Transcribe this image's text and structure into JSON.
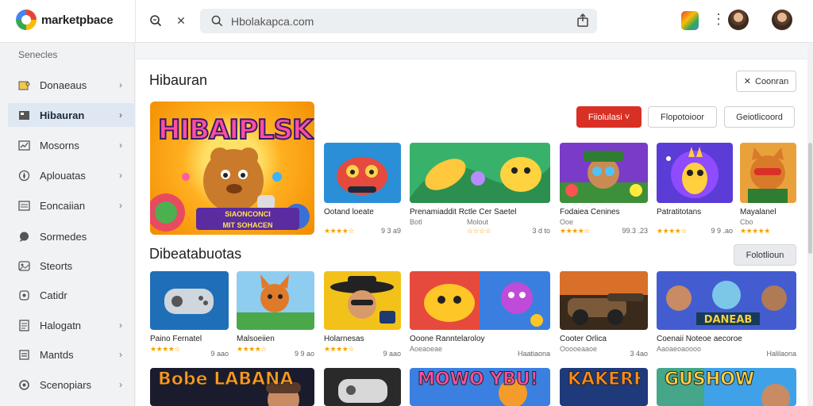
{
  "app": {
    "title": "marketpbace"
  },
  "search": {
    "value": "Hbolakapca.com",
    "placeholder": ""
  },
  "sidebar": {
    "header": "Senecles",
    "items": [
      {
        "label": "Donaeaus",
        "icon": "puzzle-icon",
        "chevron": true
      },
      {
        "label": "Hibauran",
        "icon": "grid-icon",
        "chevron": true,
        "active": true
      },
      {
        "label": "Mosorns",
        "icon": "chart-icon",
        "chevron": true
      },
      {
        "label": "Aplouatas",
        "icon": "compass-icon",
        "chevron": true
      },
      {
        "label": "Eoncaiian",
        "icon": "list-icon",
        "chevron": true
      },
      {
        "label": "Sormedes",
        "icon": "chat-icon",
        "chevron": false
      },
      {
        "label": "Steorts",
        "icon": "image-icon",
        "chevron": false
      },
      {
        "label": "Catidr",
        "icon": "tag-icon",
        "chevron": false
      },
      {
        "label": "Halogatn",
        "icon": "doc-icon",
        "chevron": true
      },
      {
        "label": "Mantds",
        "icon": "bars-icon",
        "chevron": true
      },
      {
        "label": "Scenopiars",
        "icon": "settings-icon",
        "chevron": true
      }
    ]
  },
  "section1": {
    "title": "Hibauran",
    "action_button": "Coonran",
    "filters": [
      "Fiiolulasi ˅",
      "Flopotoioor",
      "Geiotlicoord"
    ],
    "featured": {
      "art_text": "HIBAIPLSK",
      "banner_line1": "SIAONCONCI",
      "banner_line2": "MIT SOHACEN"
    },
    "tiles": [
      {
        "title": "Ootand loeate",
        "sub": "",
        "stars": "★★★★☆",
        "meta": "9 3 a9"
      },
      {
        "title": "Prenamiaddit  Rctle Cer Saetel",
        "sub": "Botl",
        "sub2": "Molout",
        "stars": "☆☆☆☆",
        "meta": "3 d to"
      },
      {
        "title": "Fodaiea Cenines",
        "sub": "Ooe",
        "stars": "★★★★☆",
        "meta": "99.3 .23"
      },
      {
        "title": "Patratitotans",
        "sub": "",
        "stars": "★★★★☆",
        "meta": "9 9 .ao"
      },
      {
        "title": "Mayalanel",
        "sub": "Cbo",
        "stars": "★★★★★",
        "meta": ""
      }
    ]
  },
  "section2": {
    "title": "Dibeatabuotas",
    "action_button": "Folotlioun",
    "tiles": [
      {
        "title": "Paino Fernatel",
        "stars": "★★★★☆",
        "meta": "9 aao"
      },
      {
        "title": "Malsoeiien",
        "stars": "★★★★☆",
        "meta": "9 9 ao"
      },
      {
        "title": "Holarnesas",
        "stars": "★★★★☆",
        "meta": "9 aao"
      },
      {
        "title": "Ooone Ranntelaroloy",
        "sub": "Aoeaoeae",
        "meta": "Haatiaona"
      },
      {
        "title": "Cooter Orlica",
        "sub": "Ooooeaaoe",
        "meta": "3 4ao"
      },
      {
        "title": "Coenaii Noteoe aecoroe",
        "sub": "Aaoaeoaoooo",
        "meta": "Halilaona"
      }
    ]
  },
  "section3": {
    "tiles": [
      {
        "art_text": "Bobe LABANA"
      },
      {
        "art_text": ""
      },
      {
        "art_text": "MOWO YBU!"
      },
      {
        "art_text": "KAKERH"
      },
      {
        "art_text": "GUSHOW"
      }
    ]
  },
  "colors": {
    "accent_red": "#d93025",
    "active_bg": "#dfe7f3",
    "star": "#f4a300"
  }
}
